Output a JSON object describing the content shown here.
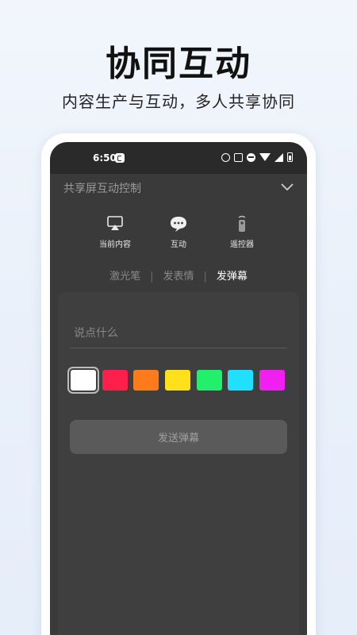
{
  "promo": {
    "headline": "协同互动",
    "subline": "内容生产与互动，多人共享协同"
  },
  "statusbar": {
    "time": "6:50",
    "icons": [
      "alarm-icon",
      "nfc-icon",
      "dnd-icon",
      "wifi-icon",
      "signal-icon",
      "battery-icon"
    ]
  },
  "panel": {
    "title": "共享屏互动控制",
    "collapse_icon": "chevron-down-icon",
    "mode_tabs": [
      {
        "label": "当前内容",
        "icon": "cast-icon"
      },
      {
        "label": "互动",
        "icon": "chat-bubble-icon"
      },
      {
        "label": "遥控器",
        "icon": "remote-icon"
      }
    ],
    "active_mode": "互动",
    "sub_tabs": [
      {
        "label": "激光笔"
      },
      {
        "label": "发表情"
      },
      {
        "label": "发弹幕"
      }
    ],
    "active_sub_tab": "发弹幕"
  },
  "danmaku": {
    "input_placeholder": "说点什么",
    "colors": [
      "#ffffff",
      "#ff1f4b",
      "#ff7a1a",
      "#ffe01a",
      "#22f06a",
      "#1fe0ff",
      "#f21ff2"
    ],
    "selected_color": "#ffffff",
    "send_label": "发送弹幕"
  }
}
